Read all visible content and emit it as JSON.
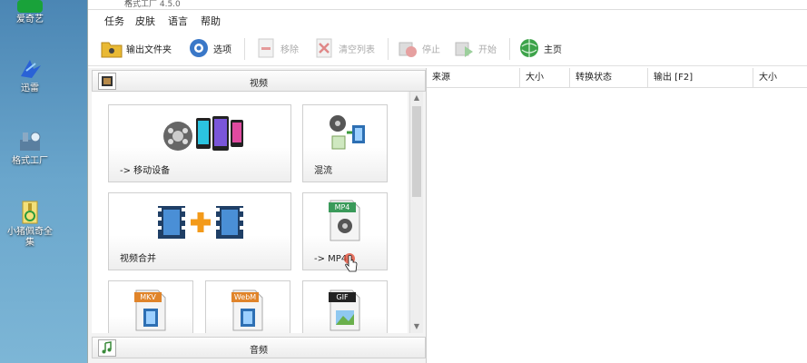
{
  "desktop": {
    "icons": [
      {
        "label": "爱奇艺",
        "icon": "app-icon",
        "color": "#19a23a"
      },
      {
        "label": "迅雷",
        "icon": "bird-icon",
        "color": "#2a62d6"
      },
      {
        "label": "格式工厂",
        "icon": "factory-icon",
        "color": "#5a7fa0"
      },
      {
        "label": "小猪佩奇全集",
        "icon": "zip-file-icon",
        "color": "#d9b63a"
      }
    ]
  },
  "window": {
    "title": "格式工厂 4.5.0",
    "close_glyph": "×",
    "menu": [
      "任务",
      "皮肤",
      "语言",
      "帮助"
    ],
    "toolbar": {
      "output_folder": "输出文件夹",
      "options": "选项",
      "remove": "移除",
      "clear_list": "清空列表",
      "stop": "停止",
      "start": "开始",
      "home": "主页"
    },
    "left": {
      "video_header": "视频",
      "audio_header": "音频",
      "tiles": [
        {
          "label": "-> 移动设备",
          "icon": "mobile-device-icon"
        },
        {
          "label": "混流",
          "icon": "mux-icon"
        },
        {
          "label": "视频合并",
          "icon": "video-merge-icon"
        },
        {
          "label": "-> MP4",
          "icon": "mp4-icon",
          "badge": "MP4"
        },
        {
          "label": "",
          "icon": "mkv-icon",
          "badge": "MKV"
        },
        {
          "label": "",
          "icon": "webm-icon",
          "badge": "WebM"
        },
        {
          "label": "",
          "icon": "gif-icon",
          "badge": "GIF"
        }
      ]
    },
    "right": {
      "columns": [
        "来源",
        "大小",
        "转换状态",
        "输出 [F2]",
        "大小"
      ]
    }
  }
}
